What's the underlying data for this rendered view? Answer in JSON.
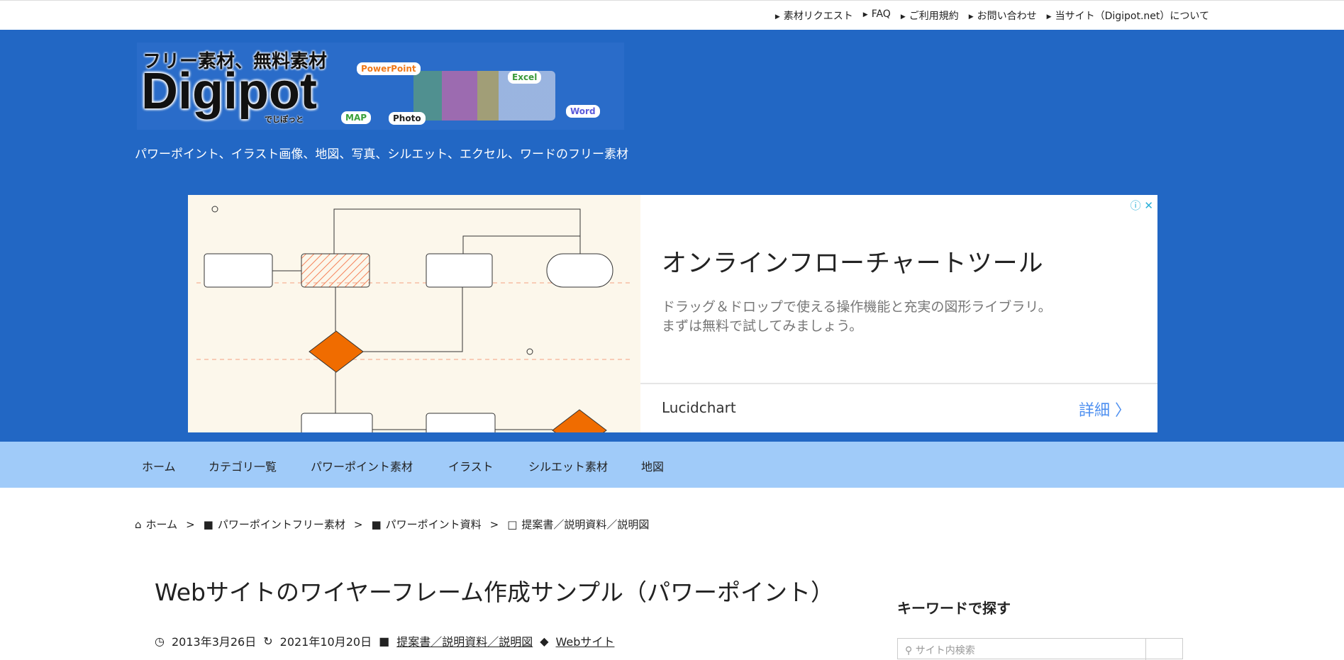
{
  "top_links": [
    "素材リクエスト",
    "FAQ",
    "ご利用規約",
    "お問い合わせ",
    "当サイト（Digipot.net）について"
  ],
  "logo": {
    "small": "フリー素材、無料素材",
    "big": "Digipot",
    "kana": "でじぽっと",
    "bubbles": [
      "PowerPoint",
      "Excel",
      "MAP",
      "Photo",
      "Word"
    ]
  },
  "tagline": "パワーポイント、イラスト画像、地図、写真、シルエット、エクセル、ワードのフリー素材",
  "ad": {
    "title": "オンラインフローチャートツール",
    "desc_line1": "ドラッグ＆ドロップで使える操作機能と充実の図形ライブラリ。",
    "desc_line2": "まずは無料で試してみましょう。",
    "brand": "Lucidchart",
    "more": "詳細",
    "colors": {
      "diamond": "#f06c00",
      "hatch": "#f5835a"
    }
  },
  "nav": [
    "ホーム",
    "カテゴリ一覧",
    "パワーポイント素材",
    "イラスト",
    "シルエット素材",
    "地図"
  ],
  "breadcrumb": [
    "ホーム",
    "パワーポイントフリー素材",
    "パワーポイント資料",
    "提案書／説明資料／説明図"
  ],
  "article": {
    "title": "Webサイトのワイヤーフレーム作成サンプル（パワーポイント）",
    "published": "2013年3月26日",
    "updated": "2021年10月20日",
    "category": "提案書／説明資料／説明図",
    "tag": "Webサイト"
  },
  "sidebar": {
    "heading": "キーワードで探す",
    "search_placeholder": "サイト内検索"
  },
  "colors": {
    "header": "#2267c4",
    "nav": "#a0cbf9"
  }
}
